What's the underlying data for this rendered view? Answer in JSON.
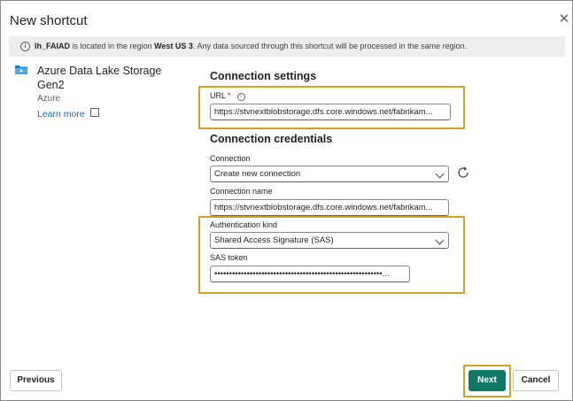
{
  "dialog": {
    "title": "New shortcut"
  },
  "banner": {
    "lakehouse": "lh_FAIAD",
    "text_before_region": " is located in the region ",
    "region": "West US 3",
    "text_after_region": ". Any data sourced through this shortcut will be processed in the same region."
  },
  "source": {
    "name": "Azure Data Lake Storage Gen2",
    "type": "Azure",
    "learn_more": "Learn more"
  },
  "connection_settings": {
    "heading": "Connection settings",
    "url_label": "URL",
    "url_required_mark": "*",
    "url_value": "https://stvnextblobstorage.dfs.core.windows.net/fabrikam..."
  },
  "connection_credentials": {
    "heading": "Connection credentials",
    "connection_label": "Connection",
    "connection_value": "Create new connection",
    "connection_name_label": "Connection name",
    "connection_name_value": "https://stvnextblobstorage.dfs.core.windows.net/fabrikam...",
    "auth_kind_label": "Authentication kind",
    "auth_kind_value": "Shared Access Signature (SAS)",
    "sas_token_label": "SAS token",
    "sas_token_value": "•••••••••••••••••••••••••••••••••••••••••••••••••••••••••..."
  },
  "footer": {
    "previous_label": "Previous",
    "next_label": "Next",
    "cancel_label": "Cancel"
  },
  "colors": {
    "primary": "#117865",
    "highlight": "#d7a024",
    "link": "#0f6cbd"
  }
}
